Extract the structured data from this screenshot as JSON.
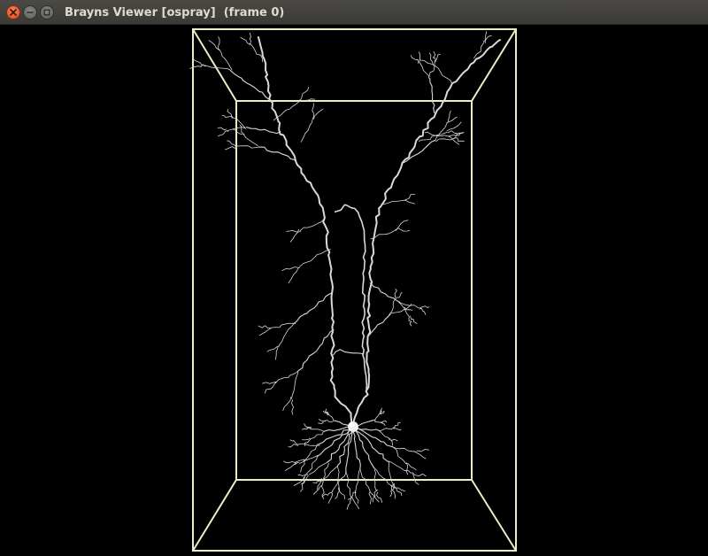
{
  "window": {
    "title": "Brayns Viewer [ospray]  (frame 0)",
    "controls": {
      "close_icon": "close-icon",
      "minimize_icon": "minimize-icon",
      "maximize_icon": "maximize-icon"
    }
  },
  "scene": {
    "background": "#000000",
    "bounding_box_color": "#e8f0c8",
    "neuron_color": "#d9d9d9",
    "soma_color": "#f0f0f0",
    "neuron_type": "pyramidal neuron"
  }
}
